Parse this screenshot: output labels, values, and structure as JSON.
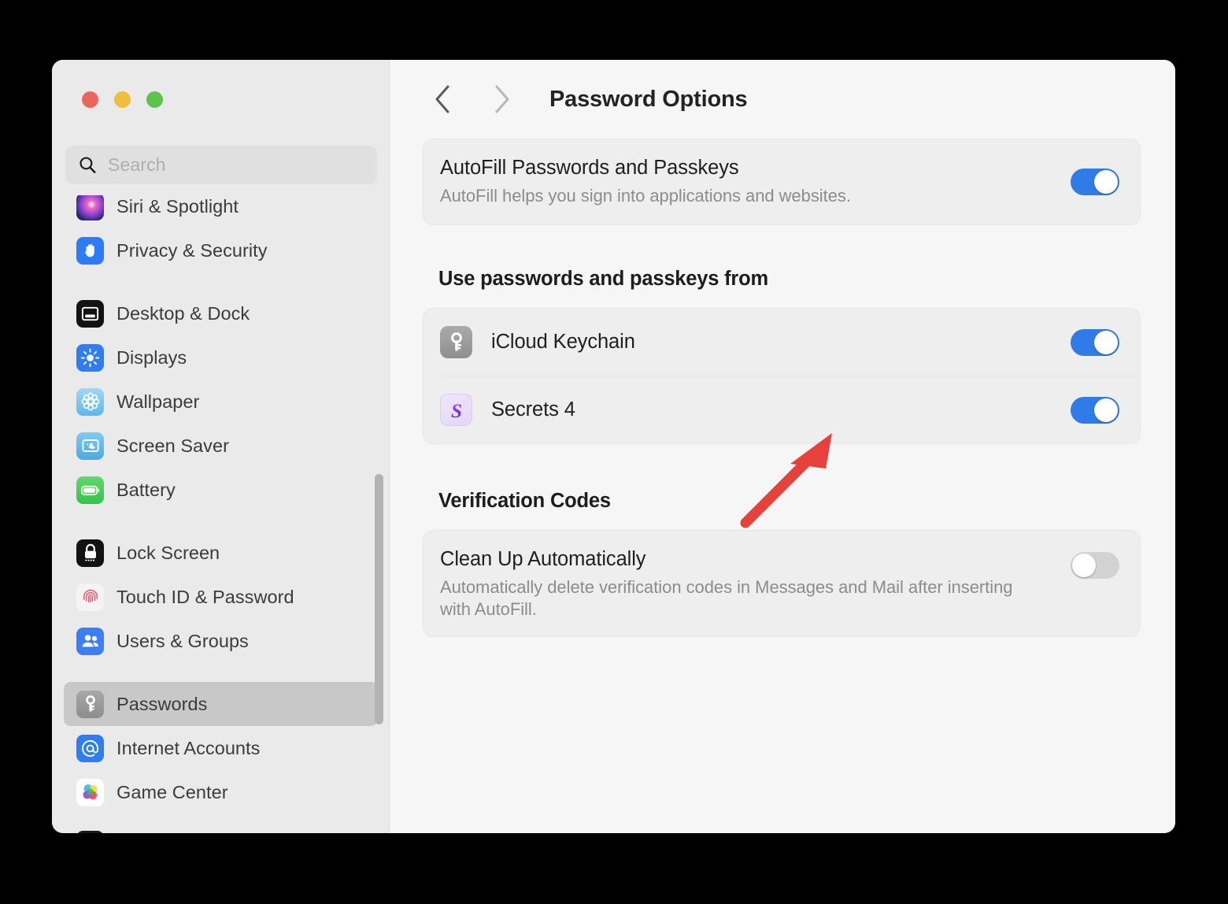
{
  "window": {
    "traffic_lights": [
      {
        "name": "close",
        "color": "#e9665c"
      },
      {
        "name": "minimize",
        "color": "#f1bd3e"
      },
      {
        "name": "zoom",
        "color": "#5cc44d"
      }
    ]
  },
  "sidebar": {
    "search": {
      "placeholder": "Search",
      "value": ""
    },
    "items": [
      {
        "label": "Siri & Spotlight",
        "icon": "siri-icon",
        "icon_class": "ic-siri",
        "selected": false,
        "group_start": false,
        "clipped_top": true
      },
      {
        "label": "Privacy & Security",
        "icon": "hand-icon",
        "icon_class": "ic-privacy",
        "selected": false,
        "group_start": false
      },
      {
        "label": "Desktop & Dock",
        "icon": "desktop-dock-icon",
        "icon_class": "ic-desktop",
        "selected": false,
        "group_start": true
      },
      {
        "label": "Displays",
        "icon": "brightness-icon",
        "icon_class": "ic-displays",
        "selected": false,
        "group_start": false
      },
      {
        "label": "Wallpaper",
        "icon": "flower-icon",
        "icon_class": "ic-wallpaper",
        "selected": false,
        "group_start": false
      },
      {
        "label": "Screen Saver",
        "icon": "screensaver-icon",
        "icon_class": "ic-saver",
        "selected": false,
        "group_start": false
      },
      {
        "label": "Battery",
        "icon": "battery-icon",
        "icon_class": "ic-battery",
        "selected": false,
        "group_start": false
      },
      {
        "label": "Lock Screen",
        "icon": "padlock-icon",
        "icon_class": "ic-lock",
        "selected": false,
        "group_start": true
      },
      {
        "label": "Touch ID & Password",
        "icon": "fingerprint-icon",
        "icon_class": "ic-touchid",
        "selected": false,
        "group_start": false
      },
      {
        "label": "Users & Groups",
        "icon": "people-icon",
        "icon_class": "ic-users",
        "selected": false,
        "group_start": false
      },
      {
        "label": "Passwords",
        "icon": "key-icon",
        "icon_class": "ic-passwords",
        "selected": true,
        "group_start": true
      },
      {
        "label": "Internet Accounts",
        "icon": "at-sign-icon",
        "icon_class": "ic-internet",
        "selected": false,
        "group_start": false
      },
      {
        "label": "Game Center",
        "icon": "game-center-icon",
        "icon_class": "ic-gamecenter",
        "selected": false,
        "group_start": false
      }
    ]
  },
  "toolbar": {
    "back_label": "Back",
    "forward_label": "Forward",
    "back_enabled": true,
    "forward_enabled": false,
    "title": "Password Options"
  },
  "main": {
    "autofill": {
      "title": "AutoFill Passwords and Passkeys",
      "subtitle": "AutoFill helps you sign into applications and websites.",
      "toggle_state": "on"
    },
    "sources_section": {
      "heading": "Use passwords and passkeys from",
      "items": [
        {
          "name": "iCloud Keychain",
          "icon": "keychain-key-icon",
          "icon_class": "keychain",
          "toggle_state": "on"
        },
        {
          "name": "Secrets 4",
          "icon": "secrets-app-icon",
          "icon_class": "secrets",
          "toggle_state": "on"
        }
      ]
    },
    "verification_section": {
      "heading": "Verification Codes",
      "clean_up": {
        "title": "Clean Up Automatically",
        "subtitle": "Automatically delete verification codes in Messages and Mail after inserting with AutoFill.",
        "toggle_state": "off"
      }
    }
  },
  "annotation": {
    "arrow_color": "#e8403a",
    "points_to": "Secrets 4"
  },
  "colors": {
    "accent_blue": "#2f7ce8",
    "toggle_off": "#d2d2d2",
    "sidebar_bg": "#eaeaea",
    "content_bg": "#f6f6f6",
    "card_bg": "#eeeeee",
    "selection_bg": "#c8c8c8",
    "desktop_bg": "#000000"
  }
}
